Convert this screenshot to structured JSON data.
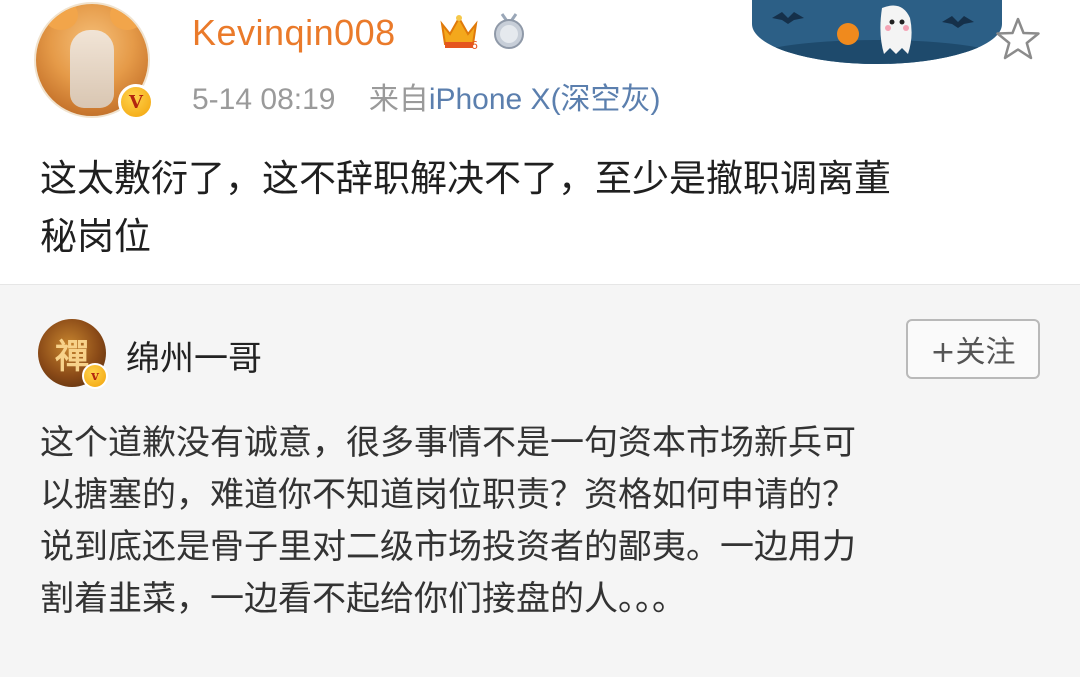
{
  "post": {
    "username": "Kevinqin008",
    "time": "5-14 08:19",
    "source_prefix": "来自",
    "source_device": "iPhone X(深空灰)",
    "verified_mark": "V",
    "content_line1": "这太敷衍了，这不辞职解决不了，至少是撤职调离董",
    "content_line2": "秘岗位"
  },
  "repost": {
    "author": "绵州一哥",
    "follow_label": "+关注",
    "avatar_char": "禪",
    "content_line1": "这个道歉没有诚意，很多事情不是一句资本市场新兵可",
    "content_line2": "以搪塞的，难道你不知道岗位职责？资格如何申请的？",
    "content_line3": "说到底还是骨子里对二级市场投资者的鄙夷。一边用力",
    "content_line4": "割着韭菜，一边看不起给你们接盘的人。。。"
  },
  "colors": {
    "username": "#ea7a2a",
    "source_link": "#5b7fae",
    "repost_bg": "#f5f5f5"
  },
  "icons": [
    "tiger-avatar-icon",
    "vip-crown-icon",
    "medal-icon",
    "halloween-banner-icon",
    "star-icon"
  ]
}
